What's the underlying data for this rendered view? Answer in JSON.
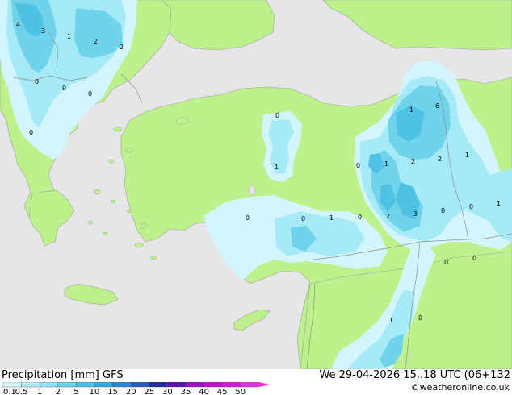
{
  "footer": {
    "title": "Precipitation [mm]  GFS",
    "valid_time": "We 29-04-2026 15..18 UTC (06+132",
    "credit": "©weatheronline.co.uk"
  },
  "legend": {
    "labels": [
      "0.1",
      "0.5",
      "1",
      "2",
      "5",
      "10",
      "15",
      "20",
      "25",
      "30",
      "35",
      "40",
      "45",
      "50"
    ],
    "colors": [
      "#d2f5ff",
      "#b4eefa",
      "#8fe2f5",
      "#6fd3ec",
      "#4ec2e4",
      "#3aa9dc",
      "#2e88cf",
      "#2a5dbe",
      "#1c2aa2",
      "#5a0fb4",
      "#9a0fc8",
      "#c80fd6",
      "#e214d2",
      "#f030e0"
    ]
  },
  "map": {
    "colors": {
      "sea": "#e6e6e6",
      "land": "#bef08c",
      "border": "#a0a0a0",
      "precip_light": "#d2f5ff",
      "precip_mid": "#a6eaf8",
      "precip_heavy": "#6fd3ec",
      "precip_heavier": "#4ec2e4"
    },
    "values": [
      {
        "id": "v1",
        "text": "4"
      },
      {
        "id": "v2",
        "text": "3"
      },
      {
        "id": "v3",
        "text": "1"
      },
      {
        "id": "v4",
        "text": "2"
      },
      {
        "id": "v5",
        "text": "2"
      },
      {
        "id": "v6",
        "text": "0"
      },
      {
        "id": "v7",
        "text": "0"
      },
      {
        "id": "v8",
        "text": "0"
      },
      {
        "id": "v9",
        "text": "0"
      },
      {
        "id": "v10",
        "text": "0"
      },
      {
        "id": "v11",
        "text": "1"
      },
      {
        "id": "v12",
        "text": "1"
      },
      {
        "id": "v13",
        "text": "6"
      },
      {
        "id": "v14",
        "text": "0"
      },
      {
        "id": "v15",
        "text": "1"
      },
      {
        "id": "v16",
        "text": "2"
      },
      {
        "id": "v17",
        "text": "2"
      },
      {
        "id": "v18",
        "text": "1"
      },
      {
        "id": "v19",
        "text": "0"
      },
      {
        "id": "v20",
        "text": "0"
      },
      {
        "id": "v21",
        "text": "1"
      },
      {
        "id": "v22",
        "text": "0"
      },
      {
        "id": "v23",
        "text": "2"
      },
      {
        "id": "v24",
        "text": "3"
      },
      {
        "id": "v25",
        "text": "0"
      },
      {
        "id": "v26",
        "text": "0"
      },
      {
        "id": "v27",
        "text": "1"
      },
      {
        "id": "v28",
        "text": "0"
      },
      {
        "id": "v29",
        "text": "0"
      },
      {
        "id": "v30",
        "text": "1"
      },
      {
        "id": "v31",
        "text": "0"
      }
    ]
  }
}
